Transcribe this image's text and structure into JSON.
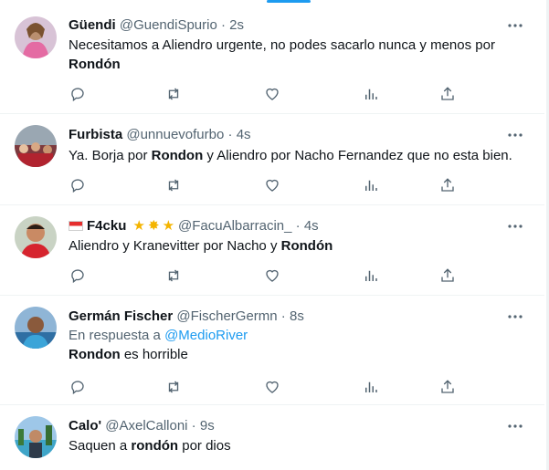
{
  "tweets": [
    {
      "name": "Güendi",
      "handle": "@GuendiSpurio",
      "time": "2s",
      "text_parts": [
        "Necesitamos a Aliendro urgente, no podes sacarlo nunca y menos por ",
        "Rondón",
        ""
      ]
    },
    {
      "name": "Furbista",
      "handle": "@unnuevofurbo",
      "time": "4s",
      "text_parts": [
        "Ya. Borja por ",
        "Rondon",
        " y Aliendro por Nacho Fernandez que no esta bien."
      ]
    },
    {
      "name": "F4cku",
      "handle": "@FacuAlbarracin_",
      "time": "4s",
      "text_parts": [
        "Aliendro y Kranevitter por Nacho y ",
        "Rondón",
        ""
      ]
    },
    {
      "name": "Germán Fischer",
      "handle": "@FischerGermn",
      "time": "8s",
      "reply_prefix": "En respuesta a ",
      "reply_to": "@MedioRiver",
      "text_parts": [
        "",
        "Rondon",
        " es horrible"
      ]
    },
    {
      "name": "Calo'",
      "handle": "@AxelCalloni",
      "time": "9s",
      "text_parts": [
        "Saquen a ",
        "rondón",
        " por dios"
      ]
    }
  ],
  "separator": " · ",
  "icons": {
    "more": "more-horizontal-icon",
    "reply": "reply-icon",
    "retweet": "retweet-icon",
    "like": "heart-icon",
    "views": "analytics-icon",
    "share": "share-icon",
    "verified_decor": "star-icon"
  },
  "colors": {
    "link": "#1d9bf0",
    "muted": "#536471",
    "text": "#0f1419",
    "star": "#f4b400"
  }
}
